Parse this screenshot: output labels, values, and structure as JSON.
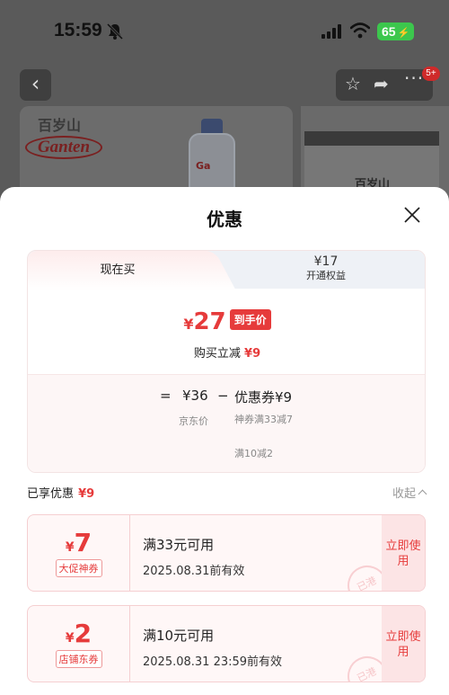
{
  "status_bar": {
    "time": "15:59",
    "battery": "65"
  },
  "background_page": {
    "brand_cn": "百岁山",
    "brand_en": "Ganten",
    "bottle_label": "Ga",
    "box_logo": "百岁山"
  },
  "sheet": {
    "title": "优惠",
    "tabs": {
      "current": "现在买",
      "member_price": "¥17",
      "member_label": "开通权益"
    },
    "final": {
      "currency": "¥",
      "price": "27",
      "tag": "到手价"
    },
    "instant_save": {
      "label": "购买立减",
      "amount": "¥9"
    },
    "breakdown": {
      "eq": "=",
      "original_price": "¥36",
      "original_label": "京东价",
      "minus": "−",
      "coupon_total": "优惠券¥9",
      "coupon_line1": "神券满33减7",
      "coupon_line2": "满10减2"
    },
    "enjoyed": {
      "label": "已享优惠",
      "amount": "¥9",
      "collapse": "收起"
    },
    "coupons": [
      {
        "currency": "¥",
        "value": "7",
        "type": "大促神券",
        "condition": "满33元可用",
        "expiry": "2025.08.31前有效",
        "action": "立即使用",
        "stamp": "已港"
      },
      {
        "currency": "¥",
        "value": "2",
        "type": "店铺东券",
        "condition": "满10元可用",
        "expiry": "2025.08.31 23:59前有效",
        "action": "立即使用",
        "stamp": "已港"
      }
    ]
  },
  "colors": {
    "accent_red": "#e63b3b",
    "battery_green": "#3cc74d"
  }
}
